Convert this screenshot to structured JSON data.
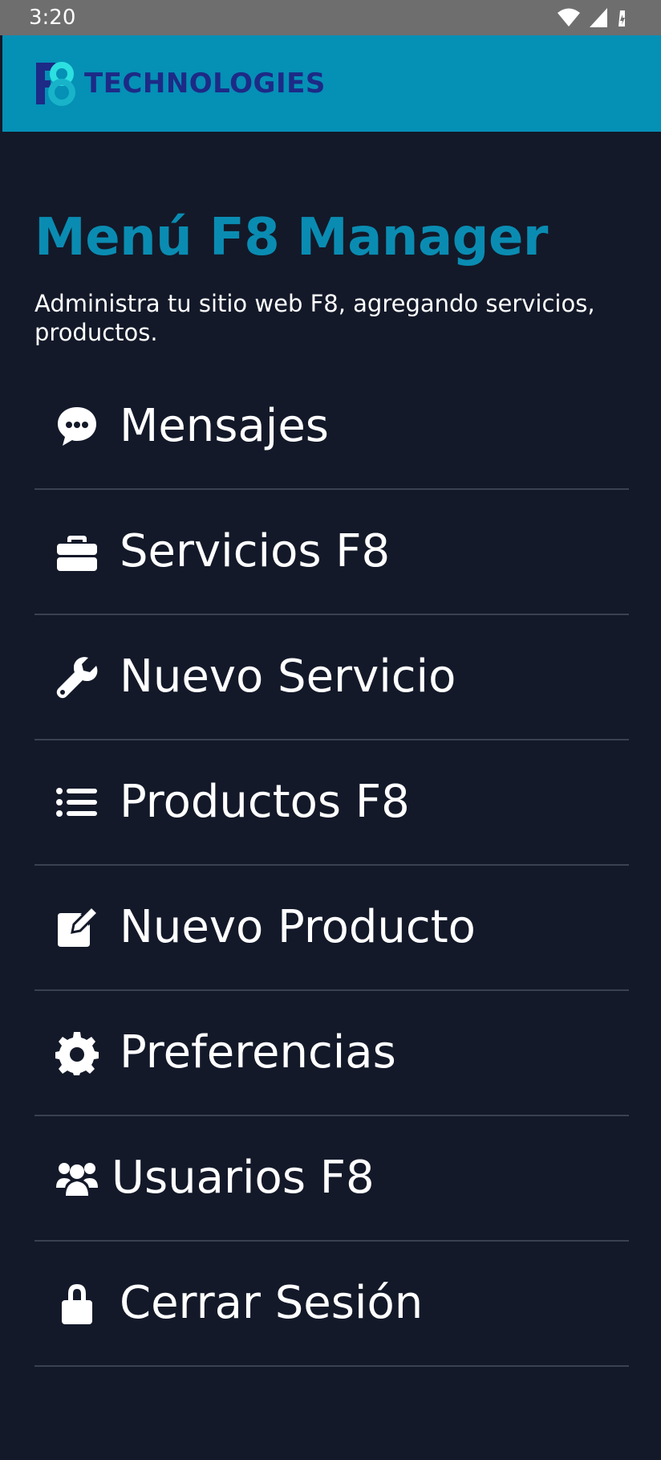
{
  "status_bar": {
    "time": "3:20",
    "icons": [
      "wifi-icon",
      "cell-signal-icon",
      "battery-icon"
    ]
  },
  "app_bar": {
    "brand_mark": "F8",
    "brand_text": "TECHNOLOGIES",
    "colors": {
      "background": "#0590b6",
      "text": "#1d2a86",
      "mark_dark": "#1d2a86",
      "mark_light": "#2ce0e0"
    }
  },
  "page": {
    "title": "Menú F8 Manager",
    "subtitle": "Administra tu sitio web F8, agregando servicios, productos.",
    "colors": {
      "background": "#131929",
      "title": "#0a8cb2",
      "divider": "#3a4150"
    }
  },
  "menu": {
    "items": [
      {
        "label": "Mensajes",
        "icon": "chat-bubble-icon"
      },
      {
        "label": "Servicios F8",
        "icon": "toolbox-icon"
      },
      {
        "label": "Nuevo Servicio",
        "icon": "wrench-icon"
      },
      {
        "label": "Productos F8",
        "icon": "list-icon"
      },
      {
        "label": "Nuevo Producto",
        "icon": "edit-square-icon"
      },
      {
        "label": "Preferencias",
        "icon": "gear-icon"
      },
      {
        "label": "Usuarios F8",
        "icon": "users-icon"
      },
      {
        "label": "Cerrar Sesión",
        "icon": "lock-icon"
      }
    ]
  }
}
